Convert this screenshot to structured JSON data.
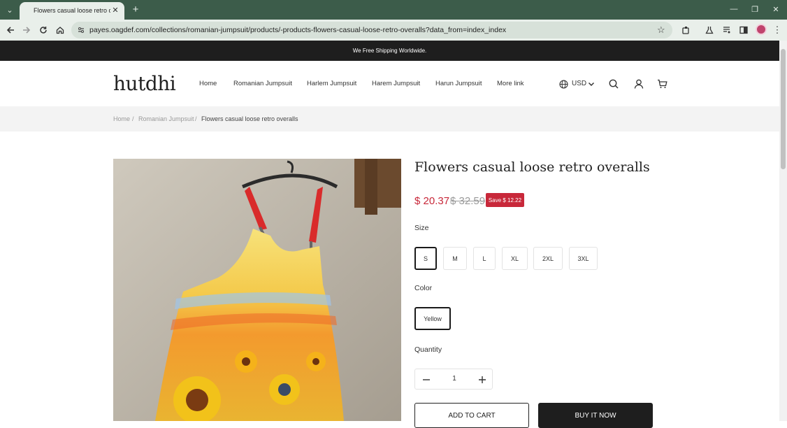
{
  "browser": {
    "tab_title": "Flowers casual loose retro overa",
    "url": "payes.oagdef.com/collections/romanian-jumpsuit/products/-products-flowers-casual-loose-retro-overalls?data_from=index_index"
  },
  "page": {
    "announcement": "We Free Shipping Worldwide.",
    "logo": "hutdhi",
    "nav": [
      "Home",
      "Romanian Jumpsuit",
      "Harlem Jumpsuit",
      "Harem Jumpsuit",
      "Harun Jumpsuit",
      "More link"
    ],
    "currency": "USD",
    "breadcrumb": [
      "Home",
      "Romanian Jumpsuit",
      "Flowers casual loose retro overalls"
    ],
    "breadcrumb_sep": "/"
  },
  "product": {
    "title": "Flowers casual loose retro overalls",
    "price": "$ 20.37",
    "compare_price": "$ 32.59",
    "save": "Save $ 12.22",
    "size_label": "Size",
    "sizes": [
      "S",
      "M",
      "L",
      "XL",
      "2XL",
      "3XL"
    ],
    "color_label": "Color",
    "colors": [
      "Yellow"
    ],
    "quantity_label": "Quantity",
    "quantity": "1",
    "add_to_cart": "ADD TO CART",
    "buy_now": "BUY IT NOW"
  },
  "colors": {
    "chrome_dark": "#3c5c4a",
    "chrome_light": "#e9efea",
    "sale_red": "#c8283a",
    "announcement_bg": "#1e1e1e"
  }
}
